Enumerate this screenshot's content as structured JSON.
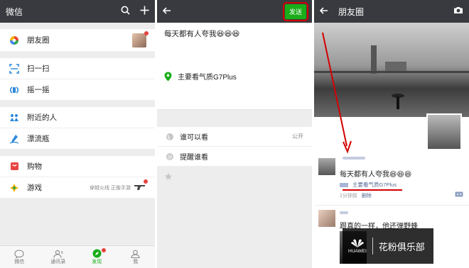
{
  "panel1": {
    "title": "微信",
    "items": {
      "moments": "朋友圈",
      "scan": "扫一扫",
      "shake": "摇一摇",
      "nearby": "附近的人",
      "bottle": "漂流瓶",
      "shopping": "购物",
      "games": "游戏",
      "games_promo": "穿越火线 正版手游"
    },
    "nav": [
      "微信",
      "通讯录",
      "发现",
      "我"
    ]
  },
  "panel2": {
    "send_label": "发送",
    "post_text": "每天都有人夸我😆😆😆",
    "location": "主要看气质G7Plus",
    "who_can_see": "谁可以看",
    "who_can_see_value": "公开",
    "remind": "提醒谁看"
  },
  "panel3": {
    "title": "朋友圈",
    "post1_text": "每天都有人夸我😆😆😆",
    "post1_location": "主要看气质G7Plus",
    "post1_time": "1分钟前",
    "post1_delete": "删除",
    "post2_text": "跟真的一样，他还弹野蜂",
    "watermark_brand": "HUAWEI",
    "watermark_text": "花粉俱乐部"
  },
  "colors": {
    "topbar": "#393a3f",
    "wechat_green": "#1aad19",
    "annotation_red": "#d40000",
    "link_blue": "#576b95"
  }
}
